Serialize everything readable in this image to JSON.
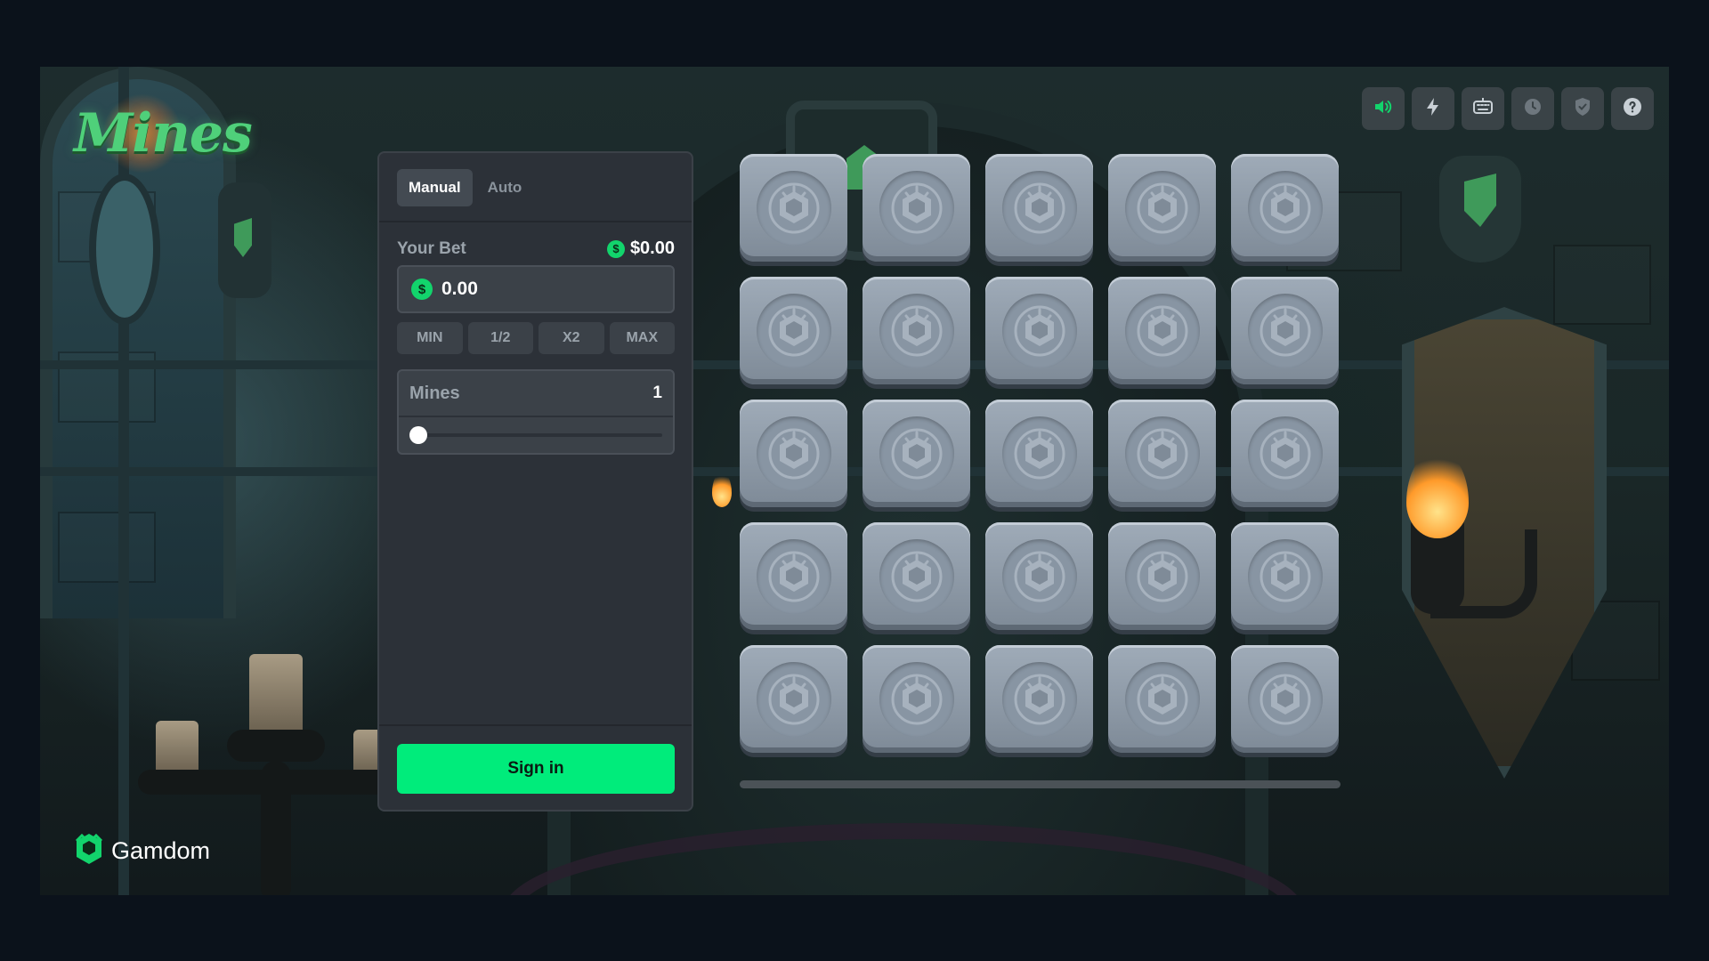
{
  "game": {
    "logo_text": "Mines"
  },
  "toolbar": {
    "items": [
      {
        "name": "sound-icon",
        "active": true
      },
      {
        "name": "lightning-icon",
        "active": false
      },
      {
        "name": "keyboard-icon",
        "active": false
      },
      {
        "name": "history-clock-icon",
        "active": false
      },
      {
        "name": "fairness-shield-icon",
        "active": false
      },
      {
        "name": "help-icon",
        "active": false
      }
    ]
  },
  "bet_panel": {
    "tabs": [
      {
        "label": "Manual",
        "active": true
      },
      {
        "label": "Auto",
        "active": false
      }
    ],
    "bet_label": "Your Bet",
    "balance": "$0.00",
    "currency_symbol": "$",
    "bet_value": "0.00",
    "quick_bets": [
      "MIN",
      "1/2",
      "X2",
      "MAX"
    ],
    "mines_label": "Mines",
    "mines_value": "1",
    "mines_slider": {
      "value": 1,
      "min": 1,
      "max": 24
    },
    "signin_label": "Sign in"
  },
  "board": {
    "rows": 5,
    "cols": 5,
    "tile_state": "hidden",
    "progress": 0
  },
  "brand": {
    "name": "Gamdom"
  },
  "colors": {
    "accent": "#00ec7b",
    "panel": "#2c3138",
    "tile": "#8e9aa7",
    "background": "#0b121b"
  }
}
